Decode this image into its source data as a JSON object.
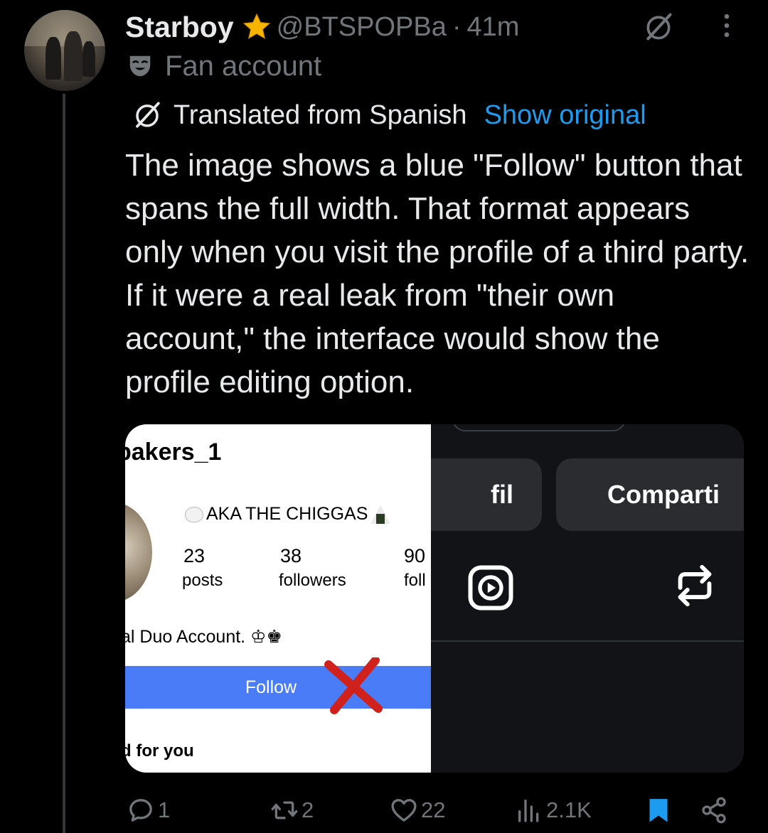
{
  "post": {
    "display_name": "Starboy",
    "handle": "@BTSPOPBa",
    "separator": "·",
    "time": "41m",
    "label": "Fan account",
    "translation_note": "Translated from Spanish",
    "show_original": "Show original",
    "text": "The image shows a blue \"Follow\" button that spans the full width. That format appears only when you visit the profile of a third party. If it were a real leak from \"their own account,\" the interface would show the profile editing option."
  },
  "media": {
    "left": {
      "username": "bakers_1",
      "aka": "AKA THE CHIGGAS",
      "stats": [
        {
          "num": "23",
          "label": "posts"
        },
        {
          "num": "38",
          "label": "followers"
        },
        {
          "num": "90",
          "label": "foll"
        }
      ],
      "bio": "al Duo Account. ♔♚",
      "follow_label": "Follow",
      "suggested": "d for you"
    },
    "right": {
      "button1": "fil",
      "button2": "Comparti"
    }
  },
  "actions": {
    "replies": "1",
    "reposts": "2",
    "likes": "22",
    "views": "2.1K"
  },
  "colors": {
    "background": "#000000",
    "text": "#e7e9ea",
    "muted": "#71767b",
    "link": "#1d9bf0",
    "star": "#f7b500",
    "follow_blue": "#4a7cf7",
    "x_mark": "#d0211c"
  }
}
